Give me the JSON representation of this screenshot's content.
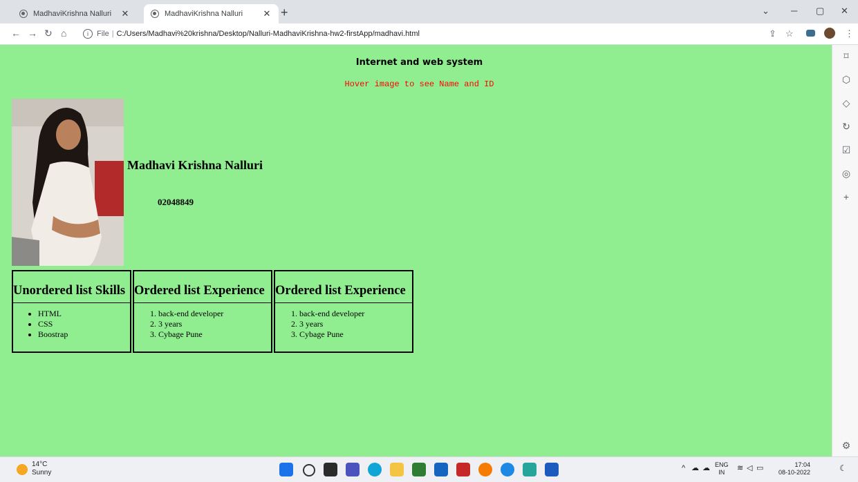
{
  "browser": {
    "tabs": [
      {
        "title": "MadhaviKrishna Nalluri",
        "active": false
      },
      {
        "title": "MadhaviKrishna Nalluri",
        "active": true
      }
    ],
    "address": {
      "scheme_label": "File",
      "url": "C:/Users/Madhavi%20krishna/Desktop/Nalluri-MadhaviKrishna-hw2-firstApp/madhavi.html"
    }
  },
  "page": {
    "heading": "Internet and web system",
    "hover_hint": "Hover image to see Name and ID",
    "name": "Madhavi Krishna Nalluri",
    "id": "02048849",
    "tables": [
      {
        "heading": "Unordered list Skills",
        "type": "ul",
        "items": [
          "HTML",
          "CSS",
          "Boostrap"
        ]
      },
      {
        "heading": "Ordered list Experience",
        "type": "ol",
        "items": [
          "back-end developer",
          "3 years",
          "Cybage Pune"
        ]
      },
      {
        "heading": "Ordered list Experience",
        "type": "ol",
        "items": [
          "back-end developer",
          "3 years",
          "Cybage Pune"
        ]
      }
    ]
  },
  "taskbar": {
    "weather_temp": "14°C",
    "weather_desc": "Sunny",
    "lang_1": "ENG",
    "lang_2": "IN",
    "time": "17:04",
    "date": "08-10-2022"
  },
  "colors": {
    "page_bg": "#90ee90",
    "hover_hint": "#ff0000"
  }
}
